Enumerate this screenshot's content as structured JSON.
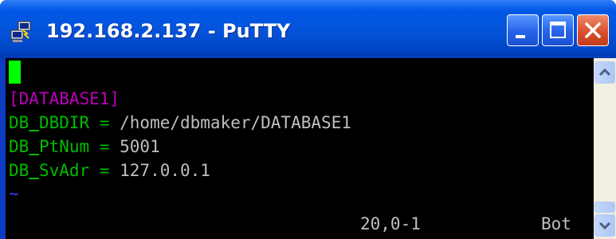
{
  "window": {
    "title": "192.168.2.137 - PuTTY",
    "icon": "putty-computers-icon"
  },
  "controls": {
    "minimize_icon": "minimize-icon",
    "maximize_icon": "maximize-icon",
    "close_icon": "close-icon"
  },
  "terminal": {
    "section_header": "[DATABASE1]",
    "lines": [
      {
        "key_prefix": "DB",
        "key_rest": "DBDIR",
        "value": "/home/dbmaker/DATABASE1"
      },
      {
        "key_prefix": "DB",
        "key_rest": "PtNum",
        "value": "5001"
      },
      {
        "key_prefix": "DB",
        "key_rest": "SvAdr",
        "value": "127.0.0.1"
      }
    ],
    "equals": "=",
    "tilde": "~",
    "status_position": "20,0-1",
    "status_scroll": "Bot"
  },
  "colors": {
    "cursor": "#00ff00",
    "section_header": "#bb00bb",
    "key": "#00bb00",
    "value": "#bfbfbf",
    "tilde": "#3b3bff",
    "title_bar": "#0055e5",
    "close_button": "#d9502d"
  }
}
